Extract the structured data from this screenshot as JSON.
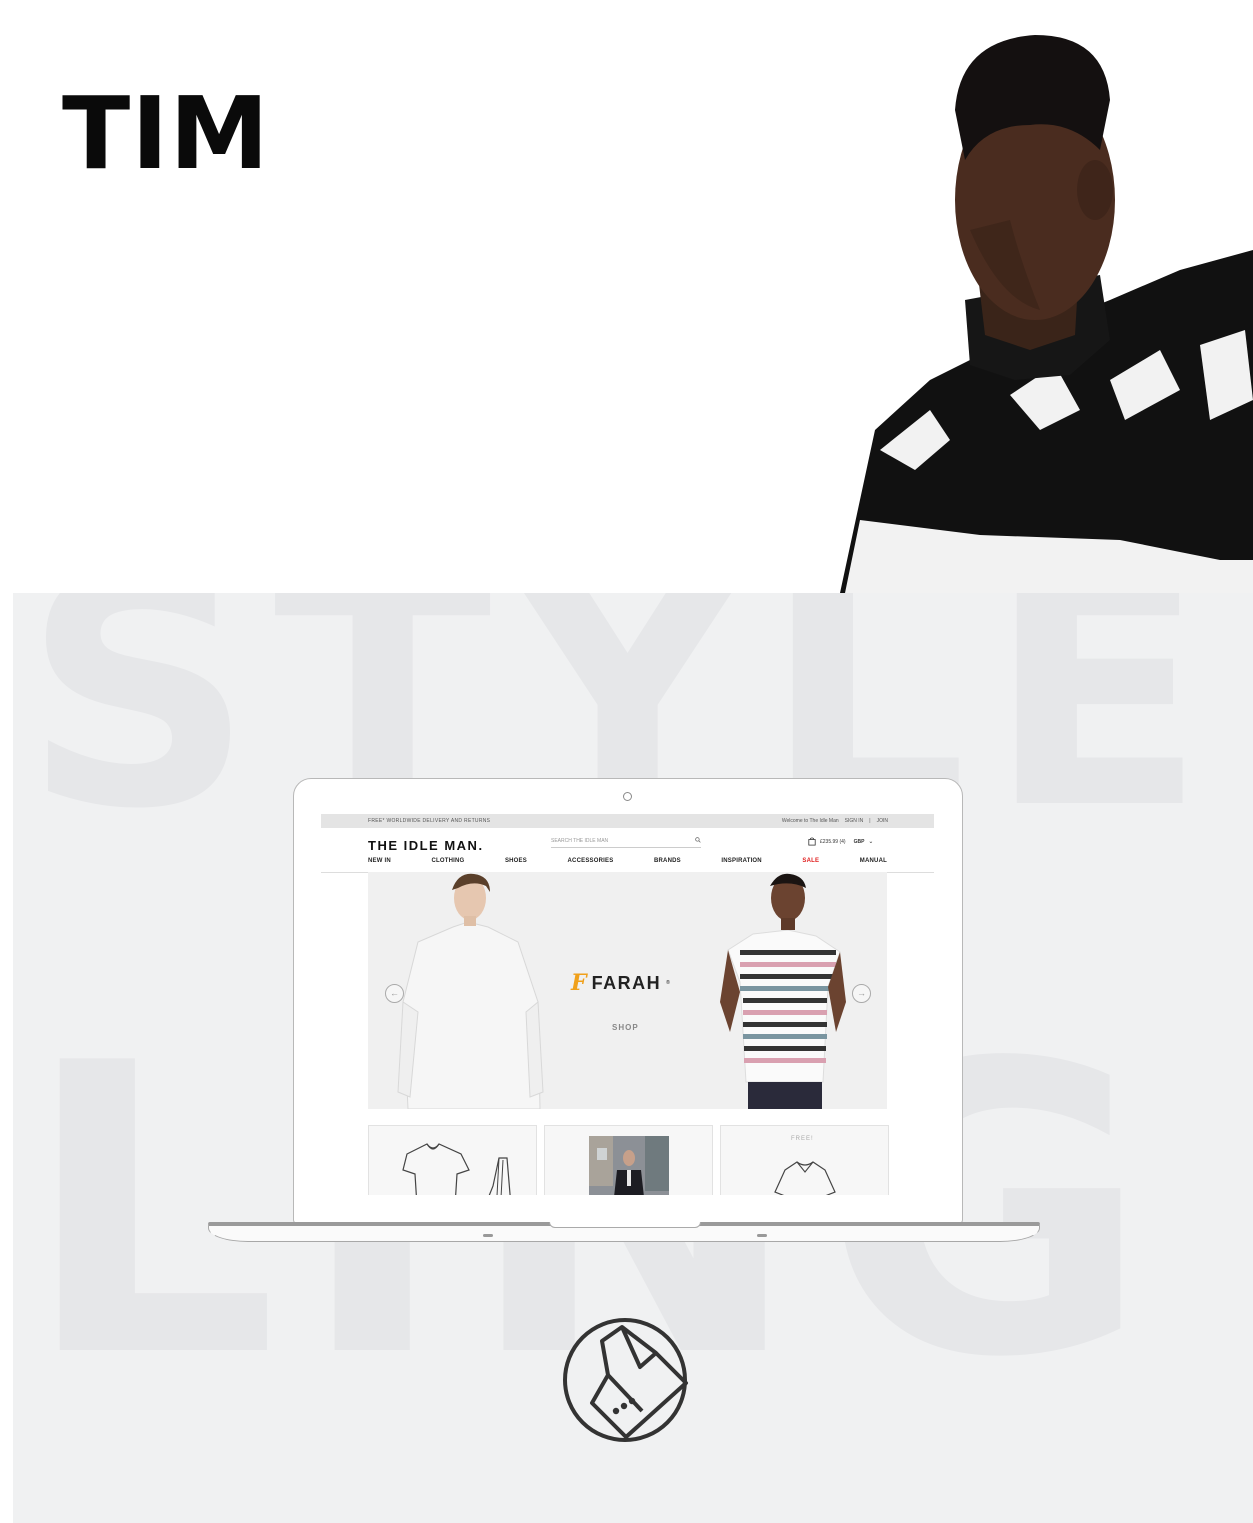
{
  "hero": {
    "title": "TIM",
    "photo_icon": "model-photo"
  },
  "background_words": [
    "STYLE",
    "LING"
  ],
  "website": {
    "topbar": {
      "delivery": "FREE* WORLDWIDE DELIVERY AND RETURNS",
      "welcome": "Welcome to The Idle Man",
      "sign_in": "SIGN IN",
      "separator": "|",
      "join": "JOIN"
    },
    "logo": "THE IDLE MAN.",
    "search": {
      "placeholder": "SEARCH THE IDLE MAN",
      "icon": "search-icon"
    },
    "cart": {
      "total": "£235.99 (4)",
      "currency": "GBP",
      "icon": "shopping-bag-icon"
    },
    "nav": [
      {
        "label": "NEW IN"
      },
      {
        "label": "CLOTHING"
      },
      {
        "label": "SHOES"
      },
      {
        "label": "ACCESSORIES"
      },
      {
        "label": "BRANDS"
      },
      {
        "label": "INSPIRATION"
      },
      {
        "label": "SALE"
      },
      {
        "label": "MANUAL"
      }
    ],
    "banner": {
      "brand_mark": "F",
      "brand": "FARAH",
      "trademark": "®",
      "cta": "SHOP",
      "prev_icon": "arrow-left-icon",
      "next_icon": "arrow-right-icon"
    },
    "tiles": [
      {
        "icon": "tshirt-icon"
      },
      {
        "icon": "street-style-photo"
      },
      {
        "label": "FREE!",
        "icon": "sweater-icon"
      }
    ],
    "accent_color": "#e02020",
    "brand_color": "#f0a01a"
  },
  "bottom_icon": "jacket-cuff-icon"
}
